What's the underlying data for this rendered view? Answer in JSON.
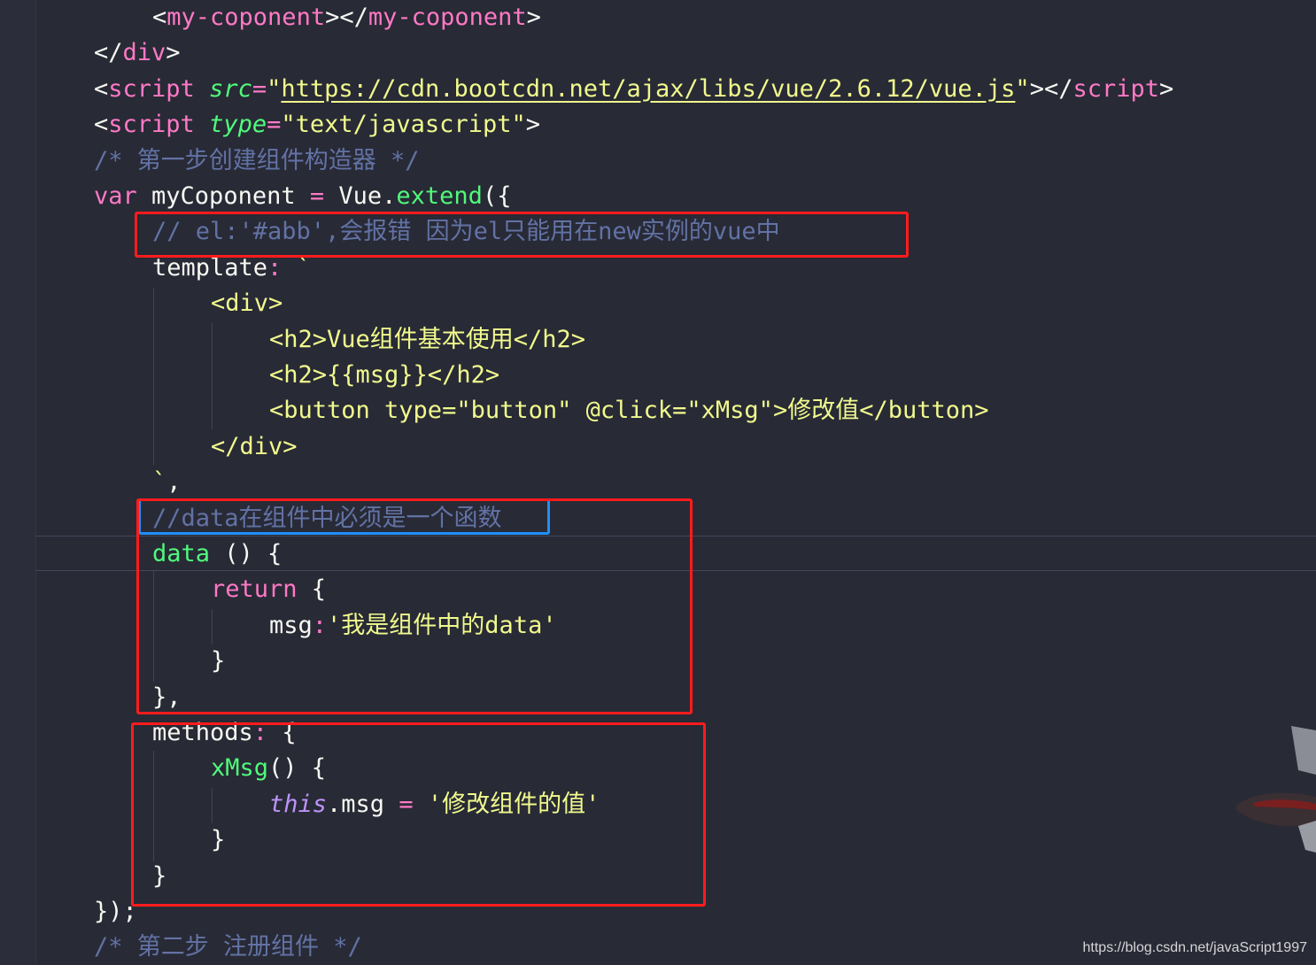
{
  "editor": {
    "theme_colors": {
      "background": "#282a36",
      "tag": "#ff79c6",
      "string": "#f1fa8c",
      "comment": "#6272a4",
      "function": "#50fa7b",
      "this": "#bd93f9",
      "annotation_red": "#ff1c1c",
      "annotation_blue": "#1e90ff"
    },
    "lines": [
      {
        "indent": 2,
        "tokens": [
          {
            "t": "<",
            "c": "punc"
          },
          {
            "t": "my-coponent",
            "c": "tag"
          },
          {
            "t": "></",
            "c": "punc"
          },
          {
            "t": "my-coponent",
            "c": "tag"
          },
          {
            "t": ">",
            "c": "punc"
          }
        ]
      },
      {
        "indent": 1,
        "tokens": [
          {
            "t": "</",
            "c": "punc"
          },
          {
            "t": "div",
            "c": "tag"
          },
          {
            "t": ">",
            "c": "punc"
          }
        ]
      },
      {
        "indent": 1,
        "tokens": [
          {
            "t": "<",
            "c": "punc"
          },
          {
            "t": "script",
            "c": "tag"
          },
          {
            "t": " ",
            "c": "punc"
          },
          {
            "t": "src",
            "c": "attr"
          },
          {
            "t": "=",
            "c": "op"
          },
          {
            "t": "\"",
            "c": "str"
          },
          {
            "t": "https://cdn.bootcdn.net/ajax/libs/vue/2.6.12/vue.js",
            "c": "url"
          },
          {
            "t": "\"",
            "c": "str"
          },
          {
            "t": "></",
            "c": "punc"
          },
          {
            "t": "script",
            "c": "tag"
          },
          {
            "t": ">",
            "c": "punc"
          }
        ]
      },
      {
        "indent": 1,
        "tokens": [
          {
            "t": "<",
            "c": "punc"
          },
          {
            "t": "script",
            "c": "tag"
          },
          {
            "t": " ",
            "c": "punc"
          },
          {
            "t": "type",
            "c": "attr"
          },
          {
            "t": "=",
            "c": "op"
          },
          {
            "t": "\"text/javascript\"",
            "c": "str"
          },
          {
            "t": ">",
            "c": "punc"
          }
        ]
      },
      {
        "indent": 1,
        "tokens": [
          {
            "t": "/* 第一步创建组件构造器 */",
            "c": "cmt"
          }
        ]
      },
      {
        "indent": 1,
        "tokens": [
          {
            "t": "var",
            "c": "kw"
          },
          {
            "t": " myCoponent ",
            "c": "punc"
          },
          {
            "t": "=",
            "c": "op"
          },
          {
            "t": " Vue.",
            "c": "punc"
          },
          {
            "t": "extend",
            "c": "fn"
          },
          {
            "t": "({",
            "c": "punc"
          }
        ]
      },
      {
        "indent": 2,
        "tokens": [
          {
            "t": "// el:'#abb',会报错 因为el只能用在new实例的vue中",
            "c": "cmt"
          }
        ]
      },
      {
        "indent": 2,
        "tokens": [
          {
            "t": "template",
            "c": "prop"
          },
          {
            "t": ":",
            "c": "op"
          },
          {
            "t": " `",
            "c": "str"
          }
        ]
      },
      {
        "indent": 3,
        "tokens": [
          {
            "t": "<div>",
            "c": "str"
          }
        ]
      },
      {
        "indent": 4,
        "tokens": [
          {
            "t": "<h2>Vue组件基本使用</h2>",
            "c": "str"
          }
        ]
      },
      {
        "indent": 4,
        "tokens": [
          {
            "t": "<h2>{{msg}}</h2>",
            "c": "str"
          }
        ]
      },
      {
        "indent": 4,
        "tokens": [
          {
            "t": "<button type=\"button\" @click=\"xMsg\">修改值</button>",
            "c": "str"
          }
        ]
      },
      {
        "indent": 3,
        "tokens": [
          {
            "t": "</div>",
            "c": "str"
          }
        ]
      },
      {
        "indent": 2,
        "tokens": [
          {
            "t": "`",
            "c": "str"
          },
          {
            "t": ",",
            "c": "punc"
          }
        ]
      },
      {
        "indent": 2,
        "tokens": [
          {
            "t": "//data在组件中必须是一个函数",
            "c": "cmt"
          }
        ]
      },
      {
        "indent": 2,
        "tokens": [
          {
            "t": "data",
            "c": "fn"
          },
          {
            "t": " () {",
            "c": "punc"
          }
        ]
      },
      {
        "indent": 3,
        "tokens": [
          {
            "t": "return",
            "c": "kw"
          },
          {
            "t": " {",
            "c": "punc"
          }
        ]
      },
      {
        "indent": 4,
        "tokens": [
          {
            "t": "msg",
            "c": "prop"
          },
          {
            "t": ":",
            "c": "op"
          },
          {
            "t": "'我是组件中的data'",
            "c": "str"
          }
        ]
      },
      {
        "indent": 3,
        "tokens": [
          {
            "t": "}",
            "c": "punc"
          }
        ]
      },
      {
        "indent": 2,
        "tokens": [
          {
            "t": "},",
            "c": "punc"
          }
        ]
      },
      {
        "indent": 2,
        "tokens": [
          {
            "t": "methods",
            "c": "prop"
          },
          {
            "t": ":",
            "c": "op"
          },
          {
            "t": " {",
            "c": "punc"
          }
        ]
      },
      {
        "indent": 3,
        "tokens": [
          {
            "t": "xMsg",
            "c": "fn"
          },
          {
            "t": "() {",
            "c": "punc"
          }
        ]
      },
      {
        "indent": 4,
        "tokens": [
          {
            "t": "this",
            "c": "this"
          },
          {
            "t": ".msg ",
            "c": "punc"
          },
          {
            "t": "=",
            "c": "op"
          },
          {
            "t": " ",
            "c": "punc"
          },
          {
            "t": "'修改组件的值'",
            "c": "str"
          }
        ]
      },
      {
        "indent": 3,
        "tokens": [
          {
            "t": "}",
            "c": "punc"
          }
        ]
      },
      {
        "indent": 2,
        "tokens": [
          {
            "t": "}",
            "c": "punc"
          }
        ]
      },
      {
        "indent": 1,
        "tokens": [
          {
            "t": "});",
            "c": "punc"
          }
        ]
      },
      {
        "indent": 1,
        "tokens": [
          {
            "t": "/* 第二步 注册组件 */",
            "c": "cmt"
          }
        ]
      }
    ]
  },
  "watermark": "https://blog.csdn.net/javaScript1997"
}
